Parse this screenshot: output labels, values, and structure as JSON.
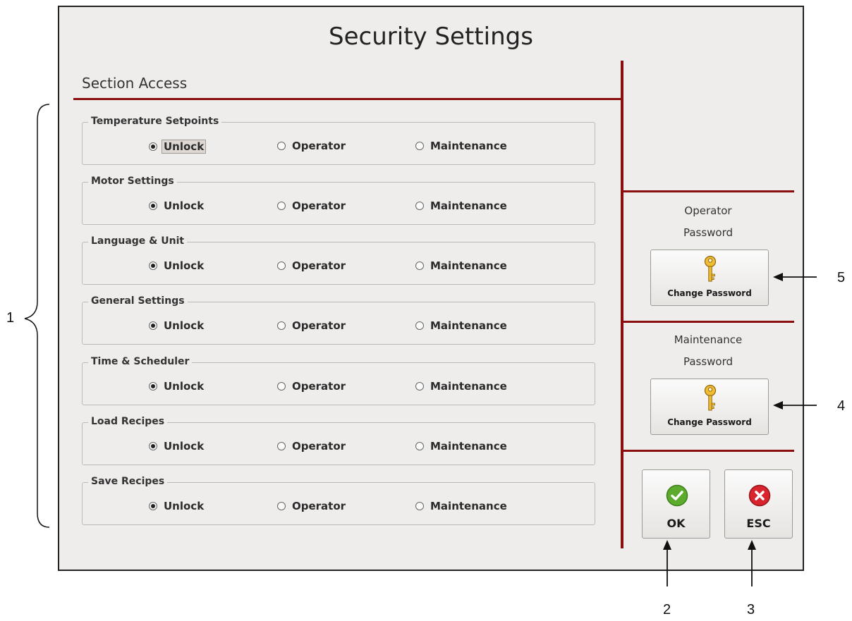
{
  "window": {
    "title": "Security Settings"
  },
  "section_title": "Section Access",
  "options": [
    "Unlock",
    "Operator",
    "Maintenance"
  ],
  "groups": [
    {
      "label": "Temperature Setpoints",
      "selected": "Unlock"
    },
    {
      "label": "Motor Settings",
      "selected": "Unlock"
    },
    {
      "label": "Language & Unit",
      "selected": "Unlock"
    },
    {
      "label": "General Settings",
      "selected": "Unlock"
    },
    {
      "label": "Time & Scheduler",
      "selected": "Unlock"
    },
    {
      "label": "Load Recipes",
      "selected": "Unlock"
    },
    {
      "label": "Save Recipes",
      "selected": "Unlock"
    }
  ],
  "operator_password": {
    "label_line1": "Operator",
    "label_line2": "Password",
    "button_label": "Change Password",
    "icon": "key-icon"
  },
  "maintenance_password": {
    "label_line1": "Maintenance",
    "label_line2": "Password",
    "button_label": "Change Password",
    "icon": "key-icon"
  },
  "ok_button": {
    "label": "OK",
    "icon": "check-icon",
    "color": "#5cab2c"
  },
  "esc_button": {
    "label": "ESC",
    "icon": "close-icon",
    "color": "#d8242c"
  },
  "accent_color": "#8b0e0e",
  "annotations": {
    "callout_1": "1",
    "callout_2": "2",
    "callout_3": "3",
    "callout_4": "4",
    "callout_5": "5"
  }
}
